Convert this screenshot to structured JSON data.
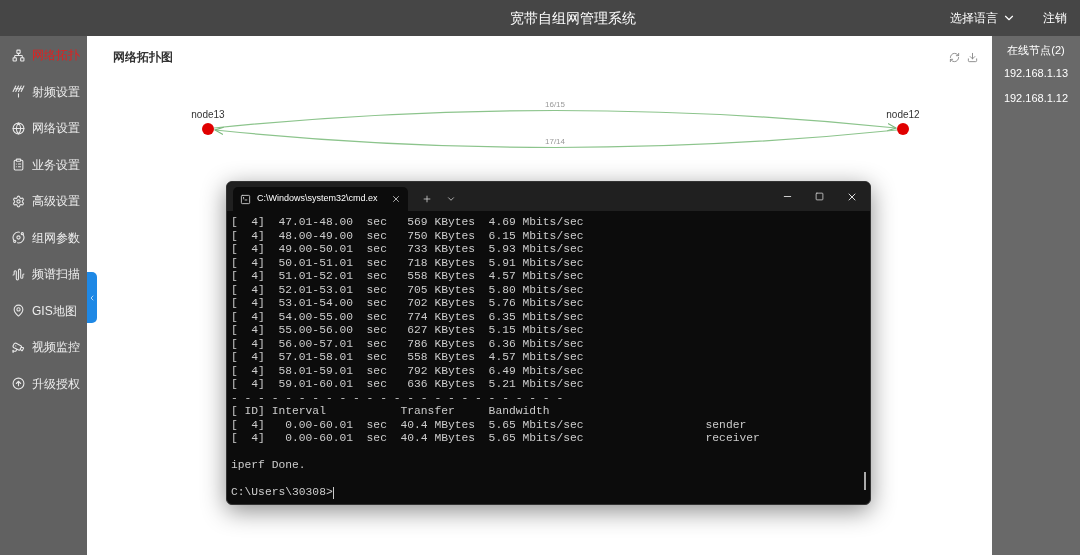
{
  "header": {
    "title": "宽带自组网管理系统",
    "language": "选择语言",
    "logout": "注销"
  },
  "sidebar": {
    "items": [
      {
        "label": "网络拓扑",
        "selected": true,
        "kind": "topology"
      },
      {
        "label": "射频设置",
        "selected": false,
        "kind": "radio"
      },
      {
        "label": "网络设置",
        "selected": false,
        "kind": "network"
      },
      {
        "label": "业务设置",
        "selected": false,
        "kind": "service"
      },
      {
        "label": "高级设置",
        "selected": false,
        "kind": "advanced"
      },
      {
        "label": "组网参数",
        "selected": false,
        "kind": "params"
      },
      {
        "label": "频谱扫描",
        "selected": false,
        "kind": "spectrum"
      },
      {
        "label": "GIS地图",
        "selected": false,
        "kind": "map"
      },
      {
        "label": "视频监控",
        "selected": false,
        "kind": "video"
      },
      {
        "label": "升级授权",
        "selected": false,
        "kind": "upgrade"
      }
    ]
  },
  "topology": {
    "title": "网络拓扑图",
    "nodes": [
      {
        "name": "node13"
      },
      {
        "name": "node12"
      }
    ],
    "links": [
      {
        "label": "16/15",
        "kind": "upper"
      },
      {
        "label": "17/14",
        "kind": "lower"
      }
    ]
  },
  "online_nodes": {
    "title": "在线节点(2)",
    "items": [
      "192.168.1.13",
      "192.168.1.12"
    ]
  },
  "terminal": {
    "tab_title": "C:\\Windows\\system32\\cmd.ex",
    "lines": [
      {
        "kind": "text",
        "text": "[  4]  47.01-48.00  sec   569 KBytes  4.69 Mbits/sec"
      },
      {
        "kind": "text",
        "text": "[  4]  48.00-49.00  sec   750 KBytes  6.15 Mbits/sec"
      },
      {
        "kind": "text",
        "text": "[  4]  49.00-50.01  sec   733 KBytes  5.93 Mbits/sec"
      },
      {
        "kind": "text",
        "text": "[  4]  50.01-51.01  sec   718 KBytes  5.91 Mbits/sec"
      },
      {
        "kind": "text",
        "text": "[  4]  51.01-52.01  sec   558 KBytes  4.57 Mbits/sec"
      },
      {
        "kind": "text",
        "text": "[  4]  52.01-53.01  sec   705 KBytes  5.80 Mbits/sec"
      },
      {
        "kind": "text",
        "text": "[  4]  53.01-54.00  sec   702 KBytes  5.76 Mbits/sec"
      },
      {
        "kind": "text",
        "text": "[  4]  54.00-55.00  sec   774 KBytes  6.35 Mbits/sec"
      },
      {
        "kind": "text",
        "text": "[  4]  55.00-56.00  sec   627 KBytes  5.15 Mbits/sec"
      },
      {
        "kind": "text",
        "text": "[  4]  56.00-57.01  sec   786 KBytes  6.36 Mbits/sec"
      },
      {
        "kind": "text",
        "text": "[  4]  57.01-58.01  sec   558 KBytes  4.57 Mbits/sec"
      },
      {
        "kind": "text",
        "text": "[  4]  58.01-59.01  sec   792 KBytes  6.49 Mbits/sec"
      },
      {
        "kind": "text",
        "text": "[  4]  59.01-60.01  sec   636 KBytes  5.21 Mbits/sec"
      },
      {
        "kind": "text",
        "text": "- - - - - - - - - - - - - - - - - - - - - - - - -"
      },
      {
        "kind": "text",
        "text": "[ ID] Interval           Transfer     Bandwidth"
      },
      {
        "kind": "text",
        "text": "[  4]   0.00-60.01  sec  40.4 MBytes  5.65 Mbits/sec                  sender"
      },
      {
        "kind": "text",
        "text": "[  4]   0.00-60.01  sec  40.4 MBytes  5.65 Mbits/sec                  receiver"
      },
      {
        "kind": "blank"
      },
      {
        "kind": "text",
        "text": "iperf Done."
      },
      {
        "kind": "blank"
      },
      {
        "kind": "prompt",
        "text": "C:\\Users\\30308>"
      }
    ]
  }
}
